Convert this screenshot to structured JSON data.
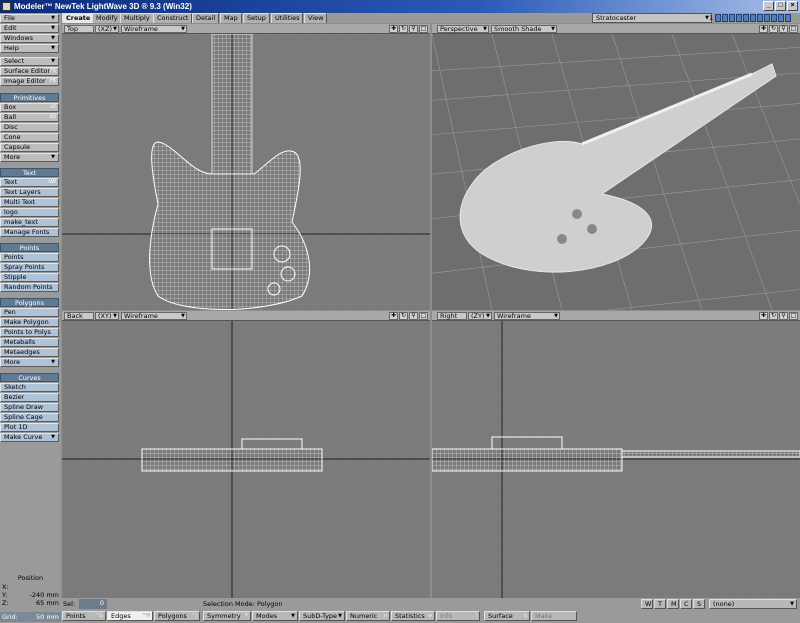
{
  "window": {
    "title": "Modeler™ NewTek LightWave 3D ® 9.3 (Win32)",
    "buttons": [
      "_",
      "□",
      "×"
    ]
  },
  "menu": [
    {
      "label": "File"
    },
    {
      "label": "Edit"
    },
    {
      "label": "Windows"
    },
    {
      "label": "Help"
    }
  ],
  "tools_top": [
    {
      "label": "Select",
      "dropdown": true
    },
    {
      "label": "Surface Editor",
      "shortcut": "F5"
    },
    {
      "label": "Image Editor",
      "shortcut": "F6"
    }
  ],
  "sections": {
    "primitives": {
      "title": "Primitives",
      "items": [
        {
          "label": "Box",
          "shortcut": "sX"
        },
        {
          "label": "Ball",
          "shortcut": "sO"
        },
        {
          "label": "Disc"
        },
        {
          "label": "Cone"
        },
        {
          "label": "Capsule"
        },
        {
          "label": "More"
        }
      ]
    },
    "text": {
      "title": "Text",
      "items": [
        {
          "label": "Text",
          "shortcut": "sW"
        },
        {
          "label": "Text Layers"
        },
        {
          "label": "Multi Text"
        },
        {
          "label": "logo"
        },
        {
          "label": "make_text"
        },
        {
          "label": "Manage Fonts"
        }
      ]
    },
    "points": {
      "title": "Points",
      "items": [
        {
          "label": "Points"
        },
        {
          "label": "Spray Points"
        },
        {
          "label": "Stipple"
        },
        {
          "label": "Random Points"
        }
      ]
    },
    "polygons": {
      "title": "Polygons",
      "items": [
        {
          "label": "Pen"
        },
        {
          "label": "Make Polygon"
        },
        {
          "label": "Points to Polys"
        },
        {
          "label": "Metaballs"
        },
        {
          "label": "Metaedges"
        },
        {
          "label": "More"
        }
      ]
    },
    "curves": {
      "title": "Curves",
      "items": [
        {
          "label": "Sketch"
        },
        {
          "label": "Bezier"
        },
        {
          "label": "Spline Draw"
        },
        {
          "label": "Spline Cage"
        },
        {
          "label": "Plot 1D"
        },
        {
          "label": "Make Curve"
        }
      ]
    }
  },
  "position": {
    "title": "Position",
    "x_label": "X:",
    "x": "",
    "y_label": "Y:",
    "y": "-240 mm",
    "z_label": "Z:",
    "z": "65 mm"
  },
  "grid": {
    "label": "Grid:",
    "value": "50 mm"
  },
  "tabs": [
    "Create",
    "Modify",
    "Multiply",
    "Construct",
    "Detail",
    "Map",
    "Setup",
    "Utilities",
    "View"
  ],
  "active_tab": "Create",
  "object_selector": "Stratocaster",
  "layer_number": "1",
  "viewports": {
    "top": {
      "view": "Top",
      "axes": "(XZ)",
      "mode": "Wireframe"
    },
    "perspective": {
      "view": "Perspective",
      "mode": "Smooth Shade"
    },
    "back": {
      "view": "Back",
      "axes": "(XY)",
      "mode": "Wireframe"
    },
    "right": {
      "view": "Right",
      "axes": "(ZY)",
      "mode": "Wireframe"
    }
  },
  "status": {
    "sel_label": "Sel:",
    "sel_value": "0",
    "selection_mode": "Selection Mode: Polygon",
    "wtmcs": [
      "W",
      "T",
      "M",
      "C",
      "S"
    ],
    "surface_value": "(none)"
  },
  "bottom_buttons": [
    {
      "label": "Points",
      "shortcut": "^G"
    },
    {
      "label": "Edges",
      "shortcut": "^H"
    },
    {
      "label": "Polygons",
      "shortcut": "^J"
    },
    {
      "label": "Symmetry",
      "shortcut": "Y"
    },
    {
      "label": "Modes"
    },
    {
      "label": "SubD-Type"
    },
    {
      "label": "Numeric",
      "shortcut": "n"
    },
    {
      "label": "Statistics",
      "shortcut": "w"
    },
    {
      "label": "Info",
      "shortcut": "i"
    },
    {
      "label": "Surface",
      "shortcut": "q"
    },
    {
      "label": "Make",
      "shortcut": ""
    }
  ],
  "colors": {
    "header_blue": "#5f7a93",
    "viewport_bg": "#7b7b7b",
    "wire": "#eeeeee"
  }
}
